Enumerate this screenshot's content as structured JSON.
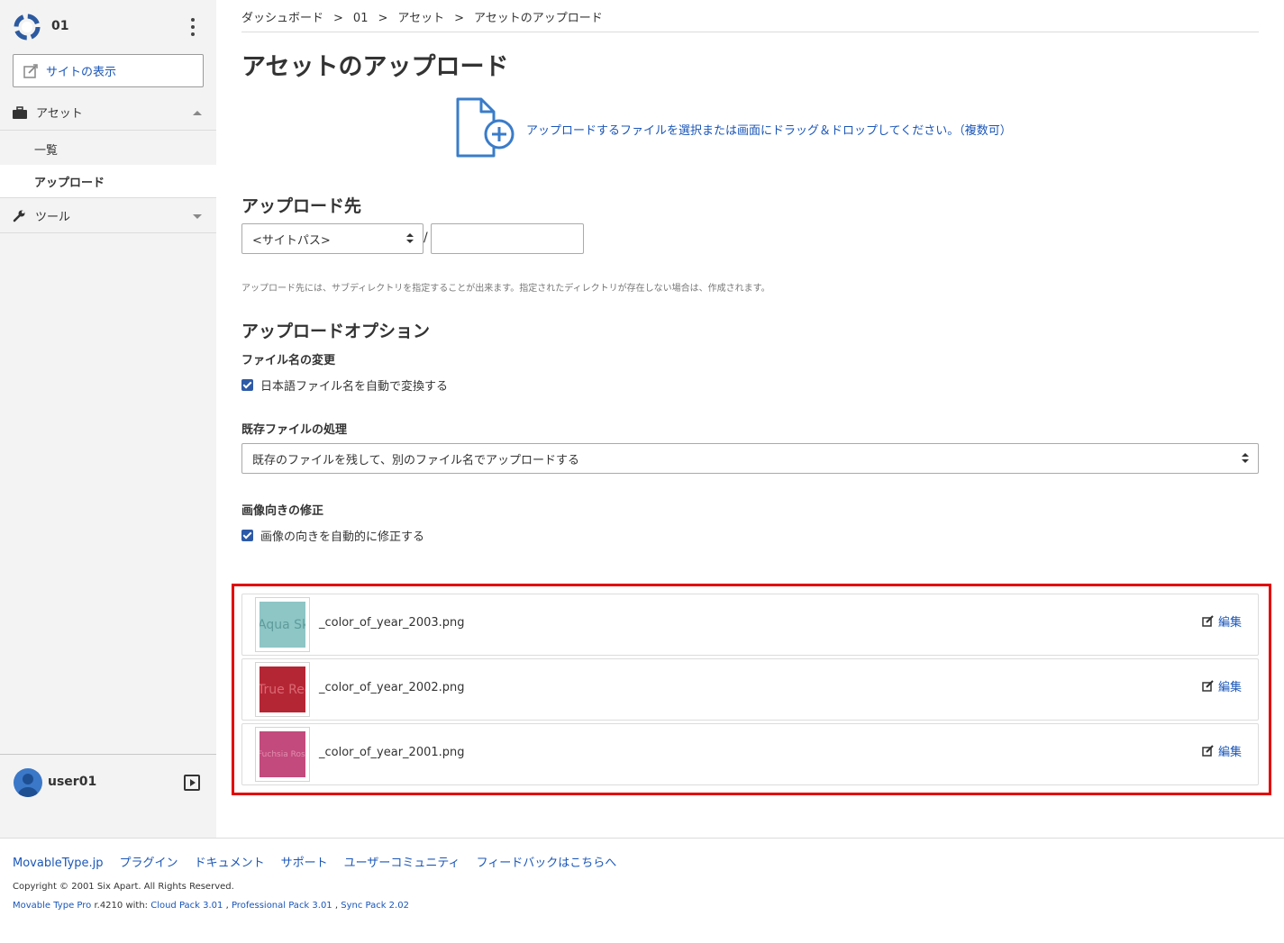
{
  "sidebar": {
    "site_name": "01",
    "view_site_label": "サイトの表示",
    "assets_label": "アセット",
    "asset_sub_items": [
      {
        "label": "一覧"
      },
      {
        "label": "アップロード"
      }
    ],
    "tools_label": "ツール",
    "username": "user01"
  },
  "breadcrumb": {
    "items": [
      "ダッシュボード",
      "01",
      "アセット",
      "アセットのアップロード"
    ],
    "separator": ">"
  },
  "page": {
    "title": "アセットのアップロード",
    "drop_zone_text": "アップロードするファイルを選択または画面にドラッグ＆ドロップしてください。（複数可）",
    "destination_title": "アップロード先",
    "site_path_select": "<サイトパス>",
    "path_separator": "/",
    "destination_input_value": "",
    "destination_help": "アップロード先には、サブディレクトリを指定することが出来ます。指定されたディレクトリが存在しない場合は、作成されます。",
    "options_title": "アップロードオプション",
    "rename_label": "ファイル名の変更",
    "rename_checkbox": "日本語ファイル名を自動で変換する",
    "rename_checked": true,
    "existing_label": "既存ファイルの処理",
    "existing_select": "既存のファイルを残して、別のファイル名でアップロードする",
    "orientation_label": "画像向きの修正",
    "orientation_checkbox": "画像の向きを自動的に修正する",
    "orientation_checked": true
  },
  "uploaded_files": [
    {
      "filename": "_color_of_year_2003.png",
      "thumb_text": "Aqua Sky",
      "thumb_color": "#8ec5c5",
      "thumb_text_color": "#5f9c9c",
      "edit_label": "編集"
    },
    {
      "filename": "_color_of_year_2002.png",
      "thumb_text": "True Red",
      "thumb_color": "#b52635",
      "thumb_text_color": "#d86b73",
      "edit_label": "編集"
    },
    {
      "filename": "_color_of_year_2001.png",
      "thumb_text": "Fuchsia Rose",
      "thumb_color": "#c34a7c",
      "thumb_text_color": "#e08fb0",
      "edit_label": "編集"
    }
  ],
  "footer": {
    "links": [
      "MovableType.jp",
      "プラグイン",
      "ドキュメント",
      "サポート",
      "ユーザーコミュニティ",
      "フィードバックはこちらへ"
    ],
    "copyright": "Copyright © 2001 Six Apart. All Rights Reserved.",
    "product": "Movable Type Pro",
    "version_text": " r.4210 with: ",
    "packs": [
      "Cloud Pack 3.01",
      "Professional Pack 3.01",
      "Sync Pack 2.02"
    ],
    "pack_separator": " , "
  },
  "colors": {
    "link": "#1a56b8",
    "sidebar_bg": "#f3f3f3",
    "highlight_frame": "#e30000",
    "checkbox": "#2d5aa8"
  }
}
